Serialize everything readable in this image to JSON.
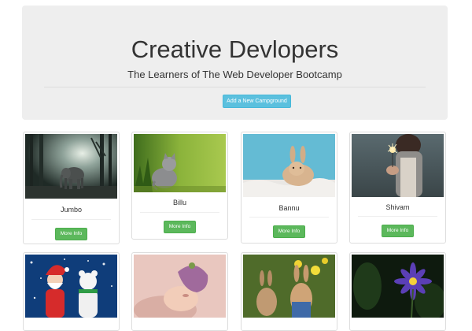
{
  "jumbotron": {
    "title": "Creative Devlopers",
    "subtitle": "The Learners of The Web Developer Bootcamp",
    "add_button_label": "Add a New Campground"
  },
  "cards": [
    {
      "name": "Jumbo",
      "button_label": "More Info",
      "image": "elephant-in-forest"
    },
    {
      "name": "Billu",
      "button_label": "More Info",
      "image": "kitten-in-grass"
    },
    {
      "name": "Bannu",
      "button_label": "More Info",
      "image": "rabbit-on-blanket"
    },
    {
      "name": "Shivam",
      "button_label": "More Info",
      "image": "person-with-sparkler"
    },
    {
      "name": "",
      "button_label": "",
      "image": "santa-and-polar-bear"
    },
    {
      "name": "",
      "button_label": "",
      "image": "sleeping-baby"
    },
    {
      "name": "",
      "button_label": "",
      "image": "rabbit-figurines-with-flowers"
    },
    {
      "name": "",
      "button_label": "",
      "image": "purple-water-lily"
    }
  ],
  "colors": {
    "jumbotron_bg": "#eeeeee",
    "info_button": "#5bc0de",
    "success_button": "#5cb85c",
    "card_border": "#dddddd"
  }
}
